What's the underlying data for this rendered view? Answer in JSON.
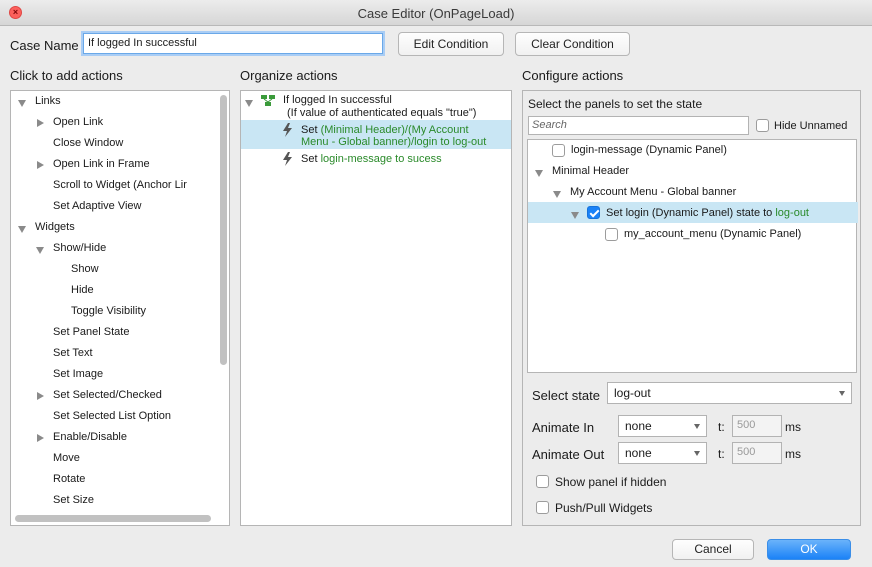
{
  "window": {
    "title": "Case Editor (OnPageLoad)"
  },
  "case_name": {
    "label": "Case Name",
    "value": "If logged In successful"
  },
  "buttons": {
    "edit_condition": "Edit Condition",
    "clear_condition": "Clear Condition",
    "cancel": "Cancel",
    "ok": "OK"
  },
  "add_actions": {
    "header": "Click to add actions",
    "items": [
      "Links",
      "Open Link",
      "Close Window",
      "Open Link in Frame",
      "Scroll to Widget (Anchor Lir",
      "Set Adaptive View",
      "Widgets",
      "Show/Hide",
      "Show",
      "Hide",
      "Toggle Visibility",
      "Set Panel State",
      "Set Text",
      "Set Image",
      "Set Selected/Checked",
      "Set Selected List Option",
      "Enable/Disable",
      "Move",
      "Rotate",
      "Set Size"
    ]
  },
  "organize": {
    "header": "Organize actions",
    "case_title": "If logged In successful",
    "case_condition": "(If value of authenticated equals \"true\")",
    "action1_prefix": "Set ",
    "action1_line1": "(Minimal Header)/(My Account",
    "action1_line2": "Menu - Global banner)/login to log-out",
    "action2_prefix": "Set ",
    "action2_target": "login-message to sucess"
  },
  "configure": {
    "header": "Configure actions",
    "select_panels_label": "Select the panels to set the state",
    "search_placeholder": "Search",
    "hide_unnamed": "Hide Unnamed",
    "panels": {
      "p1": "login-message (Dynamic Panel)",
      "p2": "Minimal Header",
      "p3": "My Account Menu - Global banner",
      "p4_prefix": "Set login (Dynamic Panel) state to ",
      "p4_state": "log-out",
      "p5": "my_account_menu (Dynamic Panel)"
    },
    "select_state_label": "Select state",
    "select_state_value": "log-out",
    "animate_in_label": "Animate In",
    "animate_in_value": "none",
    "animate_out_label": "Animate Out",
    "animate_out_value": "none",
    "t_label": "t:",
    "t_in_value": "500",
    "t_out_value": "500",
    "ms": "ms",
    "show_if_hidden": "Show panel if hidden",
    "push_pull": "Push/Pull Widgets"
  },
  "colors": {
    "accent": "#1a82f7",
    "selection": "#c9e6f4",
    "green_text": "#2a8a2a"
  }
}
